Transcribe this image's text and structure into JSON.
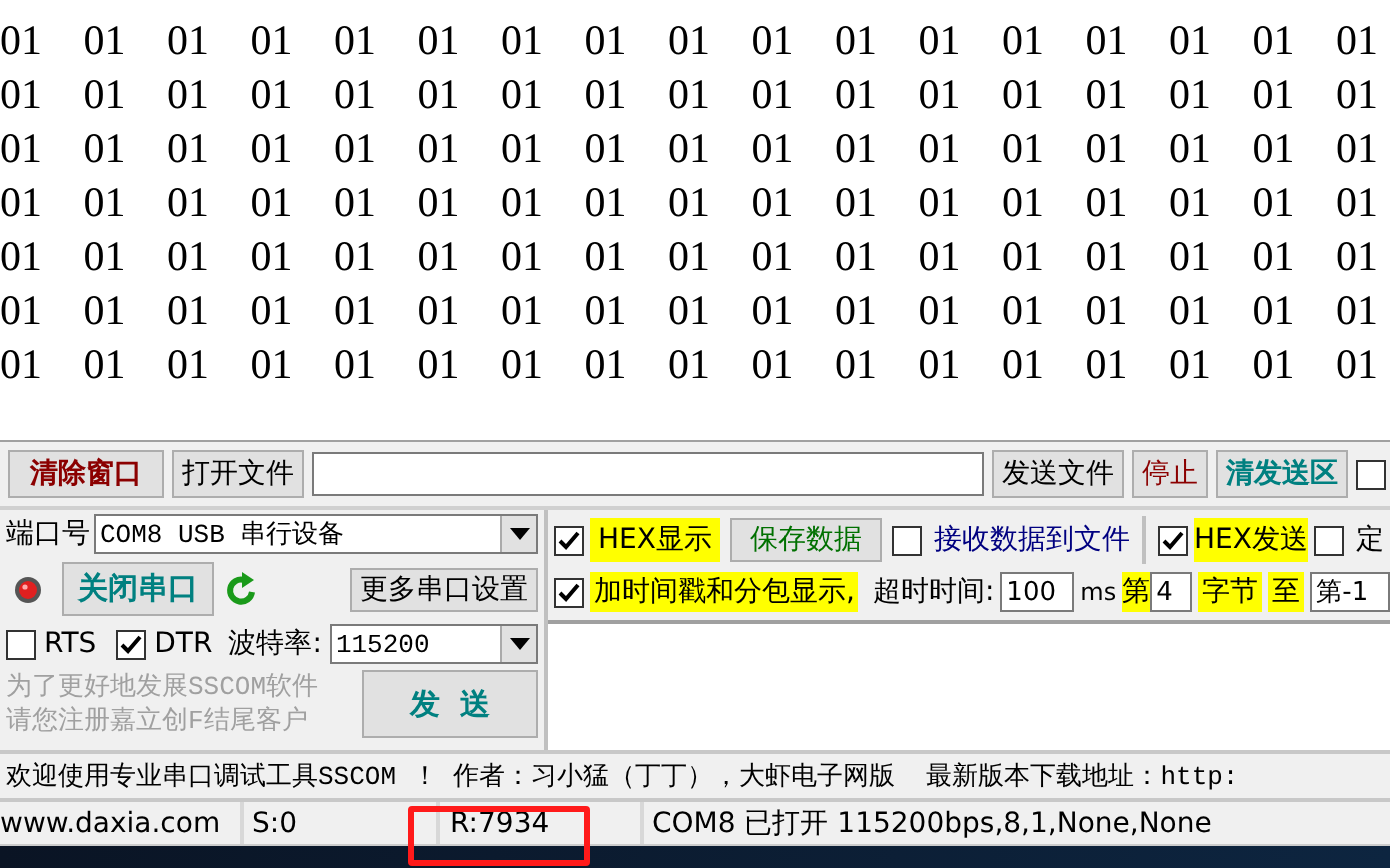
{
  "receive": {
    "lines": [
      "01 01 01 01 01 01 01 01 01 01 01 01 01 01 01 01 01",
      "01 01 01 01 01 01 01 01 01 01 01 01 01 01 01 01 01",
      "01 01 01 01 01 01 01 01 01 01 01 01 01 01 01 01 01",
      "01 01 01 01 01 01 01 01 01 01 01 01 01 01 01 01 01",
      "01 01 01 01 01 01 01 01 01 01 01 01 01 01 01 01 01",
      "01 01 01 01 01 01 01 01 01 01 01 01 01 01 01 01 01",
      "01 01 01 01 01 01 01 01 01 01 01 01 01 01 01 01 01"
    ]
  },
  "toolbar": {
    "clear_button": "清除窗口",
    "open_file_button": "打开文件",
    "send_file_button": "发送文件",
    "stop_button": "停止",
    "clear_send_button": "清发送区",
    "extra_checkbox": {
      "checked": false
    }
  },
  "port": {
    "label": "端口号",
    "value": "COM8 USB 串行设备"
  },
  "close_port_button": "关闭串口",
  "more_settings_button": "更多串口设置",
  "rts": {
    "label": "RTS",
    "checked": false
  },
  "dtr": {
    "label": "DTR",
    "checked": true
  },
  "baud": {
    "label": "波特率:",
    "value": "115200"
  },
  "notice": [
    "为了更好地发展SSCOM软件",
    "请您注册嘉立创F结尾客户"
  ],
  "send_button": "发  送",
  "hex_display": {
    "label": "HEX显示",
    "checked": true
  },
  "save_data_button": "保存数据",
  "receive_to_file": {
    "label": "接收数据到文件",
    "checked": false
  },
  "hex_send": {
    "label": "HEX发送",
    "checked": true
  },
  "timed_send": {
    "label": "定",
    "checked": false
  },
  "timestamp": {
    "label": "加时间戳和分包显示,",
    "checked": true
  },
  "timeout": {
    "label": "超时时间:",
    "value": "100",
    "unit": "ms"
  },
  "byte_from": {
    "prefix": "第",
    "value": "4",
    "suffix": "字节"
  },
  "byte_to": {
    "label": "至",
    "value": "第-1"
  },
  "marquee": "欢迎使用专业串口调试工具SSCOM ！ 作者：习小猛（丁丁），大虾电子网版  最新版本下载地址：http:",
  "status": {
    "site": "www.daxia.com",
    "sent": "S:0",
    "received": "R:7934",
    "received_highlighted": true,
    "port_status": "COM8 已打开  115200bps,8,1,None,None"
  }
}
